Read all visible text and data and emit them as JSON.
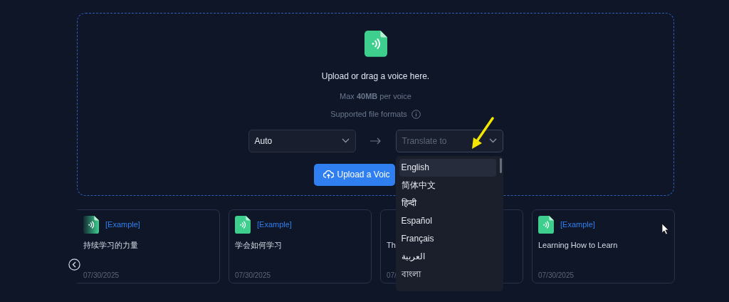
{
  "upload_area": {
    "title": "Upload or drag a voice here.",
    "limit": "Max **40MB** per voice",
    "formats_label": "Supported file formats",
    "source_select": {
      "value": "Auto"
    },
    "target_select": {
      "placeholder": "Translate to",
      "expanded": true
    },
    "upload_button": {
      "label": "Upload a Voic"
    }
  },
  "language_menu": [
    {
      "label": "English",
      "selected": true
    },
    {
      "label": "简体中文",
      "selected": false
    },
    {
      "label": "हिन्दी",
      "selected": false
    },
    {
      "label": "Español",
      "selected": false
    },
    {
      "label": "Français",
      "selected": false
    },
    {
      "label": "العربية",
      "selected": false
    },
    {
      "label": "বাংলা",
      "selected": false
    }
  ],
  "examples": [
    {
      "tag": "[Example]",
      "title": "持续学习的力量",
      "date": "07/30/2025",
      "faded": true
    },
    {
      "tag": "[Example]",
      "title": "学会如何学习",
      "date": "07/30/2025",
      "faded": false
    },
    {
      "title": "Th",
      "date": "07/",
      "faded": false
    },
    {
      "tag": "[Example]",
      "title": "Learning How to Learn",
      "date": "07/30/2025",
      "faded": false
    }
  ]
}
